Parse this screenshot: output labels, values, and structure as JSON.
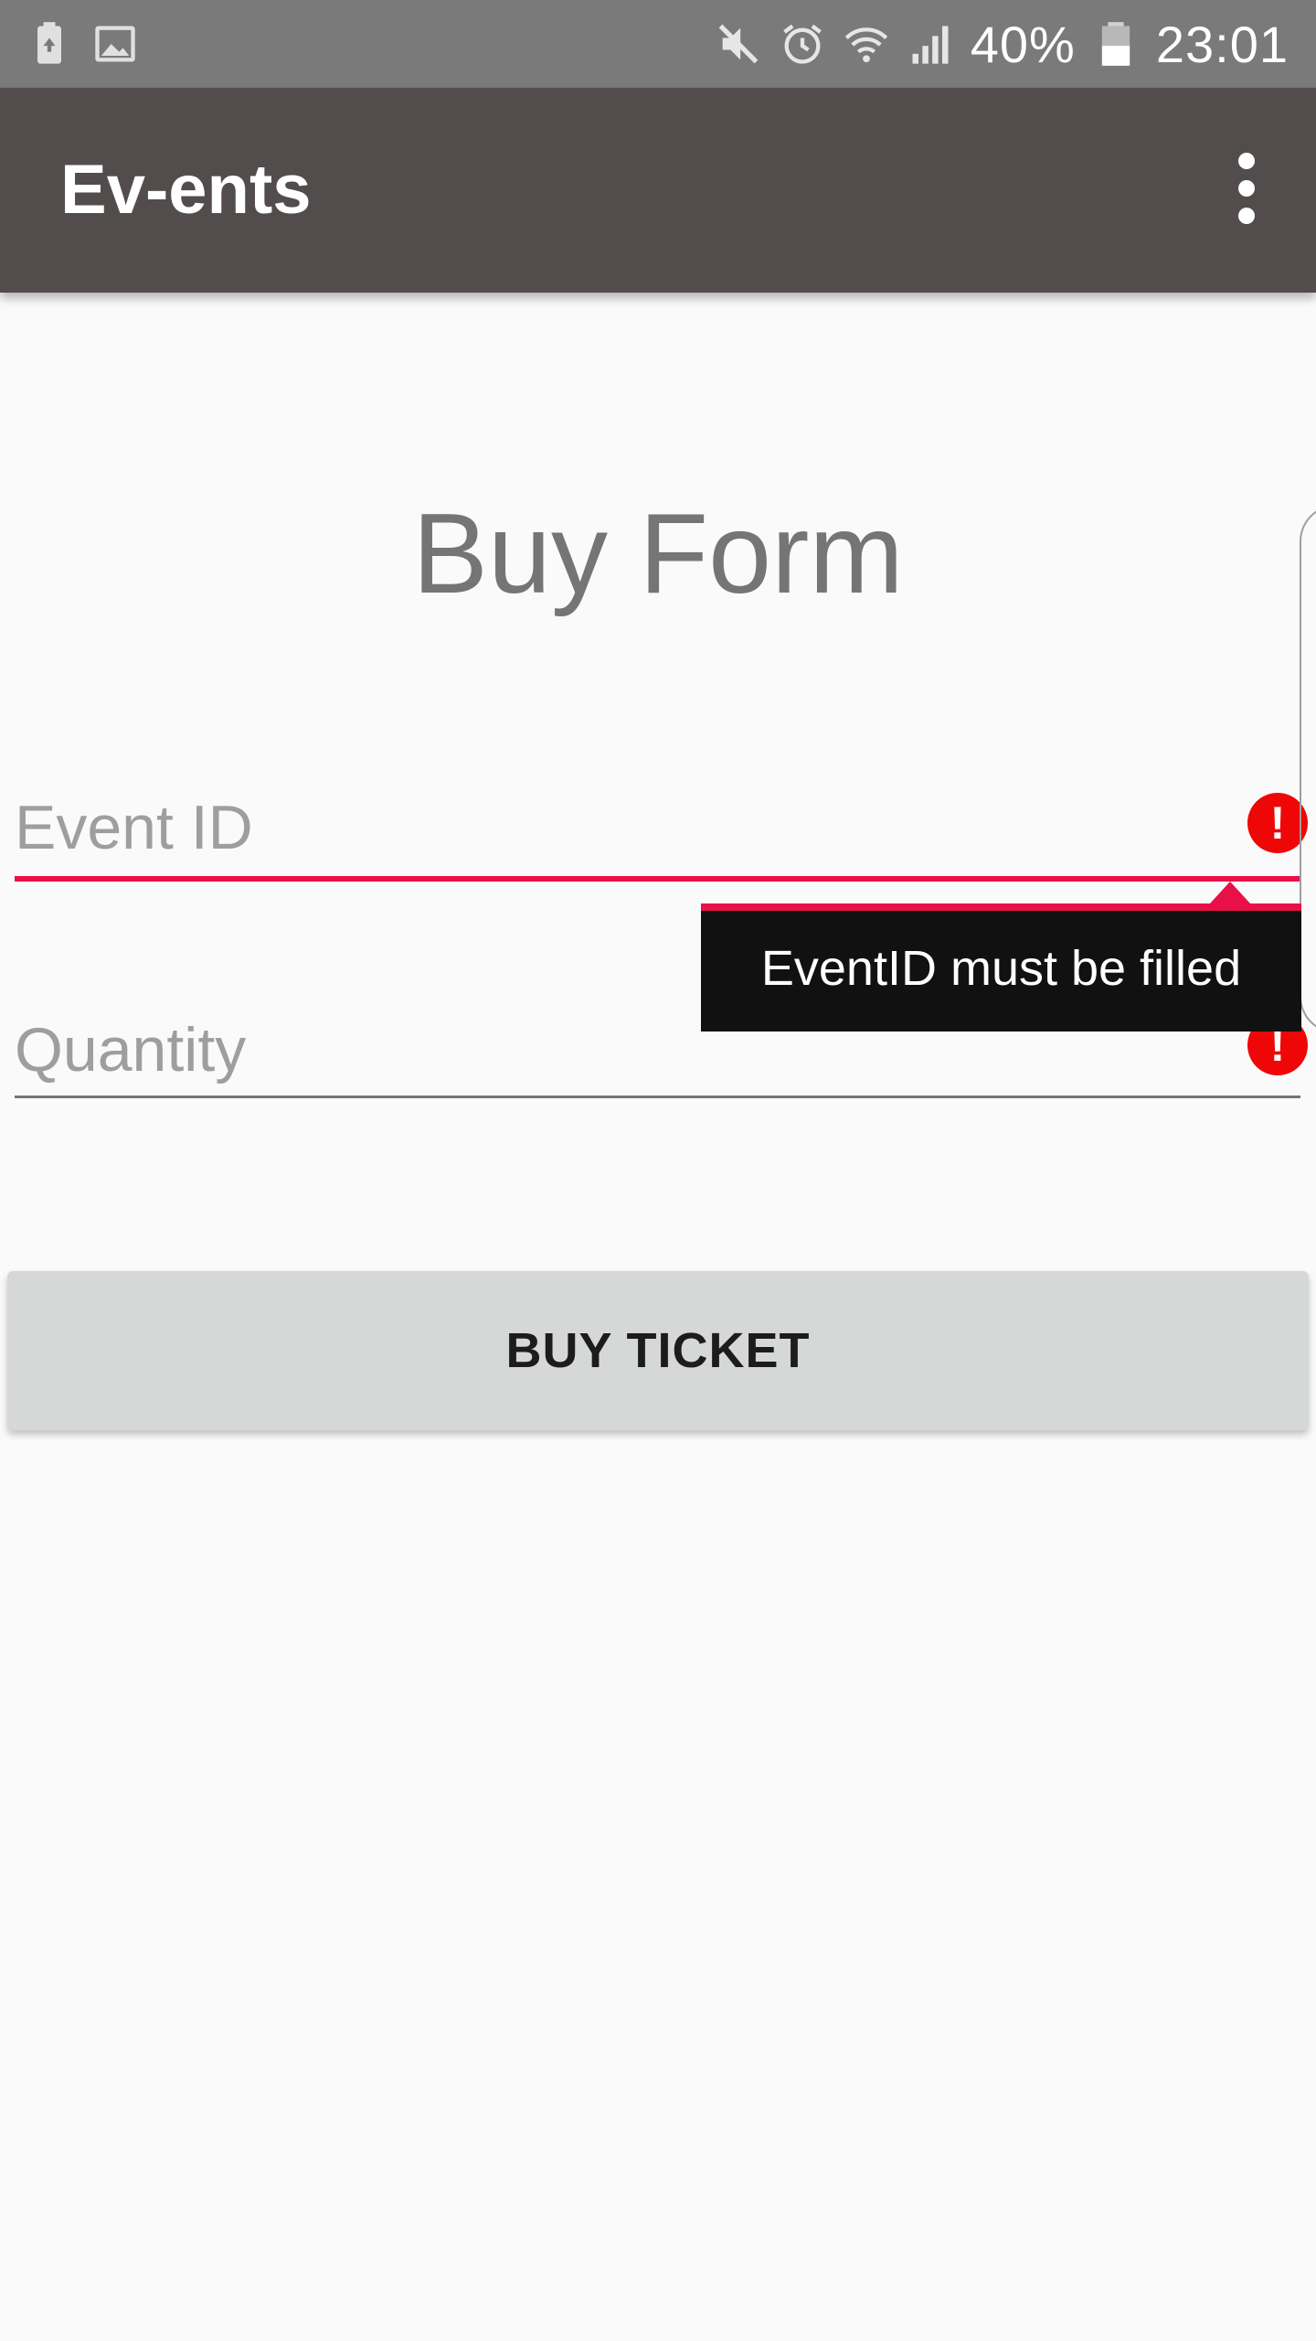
{
  "status_bar": {
    "icons_left": [
      "battery-saver-icon",
      "image-icon"
    ],
    "icons_right": [
      "mute-icon",
      "alarm-icon",
      "wifi-icon",
      "signal-icon"
    ],
    "battery_percent": "40%",
    "battery_icon": "battery-icon",
    "time": "23:01"
  },
  "app_bar": {
    "title": "Ev-ents",
    "menu_icon": "overflow-menu-icon"
  },
  "form": {
    "title": "Buy Form",
    "event_id": {
      "placeholder": "Event ID",
      "value": "",
      "error_icon": "error-icon",
      "error_symbol": "!"
    },
    "quantity": {
      "placeholder": "Quantity",
      "value": "",
      "error_icon": "error-icon",
      "error_symbol": "!"
    },
    "error_popup": {
      "message": "EventID must be filled"
    },
    "buy_button": {
      "label": "BUY TICKET"
    }
  },
  "colors": {
    "status_bar_bg": "#7a7a7a",
    "app_bar_bg": "#524c4c",
    "page_bg": "#fafafa",
    "error_accent": "#e91048",
    "error_icon_bg": "#ef0707",
    "button_bg": "#d6d7d7",
    "popup_bg": "#111111"
  }
}
